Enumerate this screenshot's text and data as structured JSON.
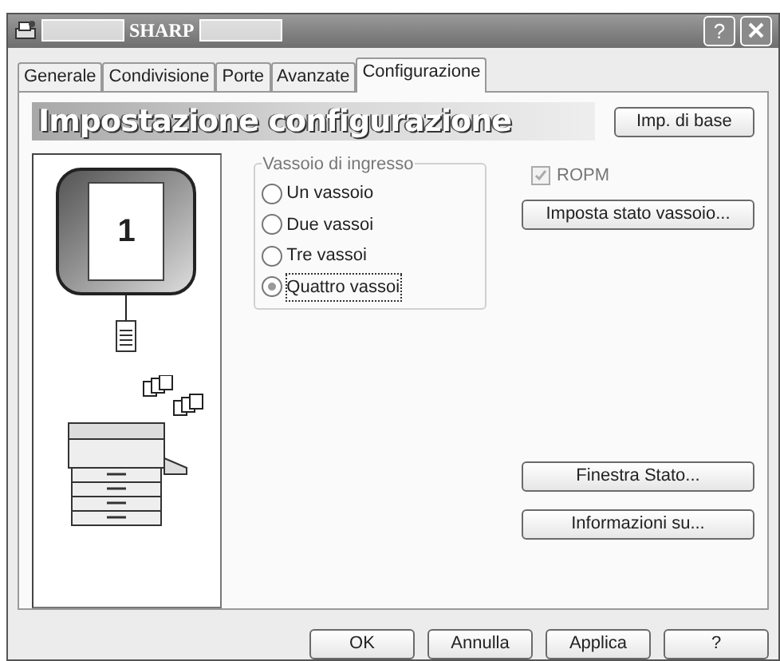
{
  "window": {
    "title": "SHARP",
    "help_label": "?"
  },
  "tabs": [
    {
      "label": "Generale",
      "selected": false
    },
    {
      "label": "Condivisione",
      "selected": false
    },
    {
      "label": "Porte",
      "selected": false
    },
    {
      "label": "Avanzate",
      "selected": false
    },
    {
      "label": "Configurazione",
      "selected": true
    }
  ],
  "header": {
    "title": "Impostazione configurazione",
    "button": {
      "label": "Imp. di base"
    }
  },
  "preview": {
    "tray_number": "1"
  },
  "input_tray": {
    "title": "Vassoio di ingresso",
    "options": [
      {
        "label": "Un vassoio",
        "selected": false
      },
      {
        "label": "Due vassoi",
        "selected": false
      },
      {
        "label": "Tre vassoi",
        "selected": false
      },
      {
        "label": "Quattro vassoi",
        "selected": true
      }
    ]
  },
  "ropm": {
    "label": "ROPM",
    "checked": true,
    "disabled": true
  },
  "buttons_top": [
    {
      "label": "Imposta stato vassoio..."
    }
  ],
  "buttons_bottom": [
    {
      "label": "Finestra Stato..."
    },
    {
      "label": "Informazioni su..."
    }
  ],
  "dialog_buttons": [
    {
      "label": "OK"
    },
    {
      "label": "Annulla"
    },
    {
      "label": "Applica"
    },
    {
      "label": "?"
    }
  ]
}
